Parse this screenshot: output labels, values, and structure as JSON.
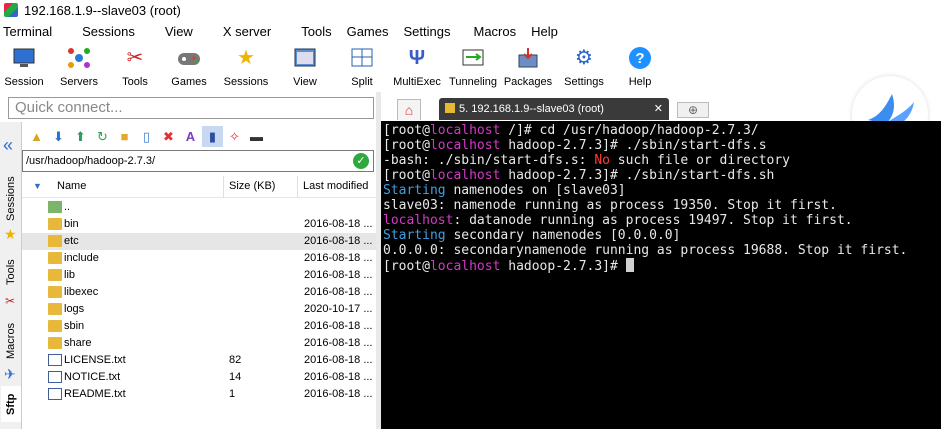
{
  "window": {
    "title": "192.168.1.9--slave03 (root)"
  },
  "menu": [
    "Terminal",
    "Sessions",
    "View",
    "X server",
    "Tools",
    "Games",
    "Settings",
    "Macros",
    "Help"
  ],
  "toolbar": [
    {
      "label": "Session",
      "icon": "session-icon"
    },
    {
      "label": "Servers",
      "icon": "servers-icon"
    },
    {
      "label": "Tools",
      "icon": "tools-icon"
    },
    {
      "label": "Games",
      "icon": "games-icon"
    },
    {
      "label": "Sessions",
      "icon": "star-icon"
    },
    {
      "label": "View",
      "icon": "view-icon"
    },
    {
      "label": "Split",
      "icon": "split-icon"
    },
    {
      "label": "MultiExec",
      "icon": "multiexec-icon"
    },
    {
      "label": "Tunneling",
      "icon": "tunneling-icon"
    },
    {
      "label": "Packages",
      "icon": "packages-icon"
    },
    {
      "label": "Settings",
      "icon": "gear-icon"
    },
    {
      "label": "Help",
      "icon": "help-icon"
    }
  ],
  "quick_connect": {
    "placeholder": "Quick connect..."
  },
  "side_tabs": [
    "Sessions",
    "Tools",
    "Macros",
    "Sftp"
  ],
  "sftp": {
    "path": "/usr/hadoop/hadoop-2.7.3/",
    "columns": {
      "name": "Name",
      "size": "Size (KB)",
      "modified": "Last modified"
    },
    "files": [
      {
        "name": "..",
        "size": "",
        "modified": "",
        "kind": "up"
      },
      {
        "name": "bin",
        "size": "",
        "modified": "2016-08-18 ...",
        "kind": "folder"
      },
      {
        "name": "etc",
        "size": "",
        "modified": "2016-08-18 ...",
        "kind": "folder"
      },
      {
        "name": "include",
        "size": "",
        "modified": "2016-08-18 ...",
        "kind": "folder"
      },
      {
        "name": "lib",
        "size": "",
        "modified": "2016-08-18 ...",
        "kind": "folder"
      },
      {
        "name": "libexec",
        "size": "",
        "modified": "2016-08-18 ...",
        "kind": "folder"
      },
      {
        "name": "logs",
        "size": "",
        "modified": "2020-10-17 ...",
        "kind": "folder"
      },
      {
        "name": "sbin",
        "size": "",
        "modified": "2016-08-18 ...",
        "kind": "folder"
      },
      {
        "name": "share",
        "size": "",
        "modified": "2016-08-18 ...",
        "kind": "folder"
      },
      {
        "name": "LICENSE.txt",
        "size": "82",
        "modified": "2016-08-18 ...",
        "kind": "file"
      },
      {
        "name": "NOTICE.txt",
        "size": "14",
        "modified": "2016-08-18 ...",
        "kind": "file"
      },
      {
        "name": "README.txt",
        "size": "1",
        "modified": "2016-08-18 ...",
        "kind": "file"
      }
    ]
  },
  "tab": {
    "home_icon": "home-icon",
    "session_label": "5. 192.168.1.9--slave03 (root)"
  },
  "terminal": {
    "l1_a": "[root@",
    "l1_b": "localhost",
    "l1_c": " /]# cd /usr/hadoop/hadoop-2.7.3/",
    "l2_a": "[root@",
    "l2_b": "localhost",
    "l2_c": " hadoop-2.7.3]# ./sbin/start-dfs.s",
    "l3_a": "-bash: ./sbin/start-dfs.s: ",
    "l3_b": "No",
    "l3_c": " such file or directory",
    "l4_a": "[root@",
    "l4_b": "localhost",
    "l4_c": " hadoop-2.7.3]# ./sbin/start-dfs.sh",
    "l5_a": "Starting",
    "l5_b": " namenodes on [slave03]",
    "l6": "slave03: namenode running as process 19350. Stop it first.",
    "l7_a": "localhost",
    "l7_b": ": datanode running as process 19497. Stop it first.",
    "l8_a": "Starting",
    "l8_b": " secondary namenodes [0.0.0.0]",
    "l9": "0.0.0.0: secondarynamenode running as process 19688. Stop it first.",
    "l10_a": "[root@",
    "l10_b": "localhost",
    "l10_c": " hadoop-2.7.3]# "
  }
}
